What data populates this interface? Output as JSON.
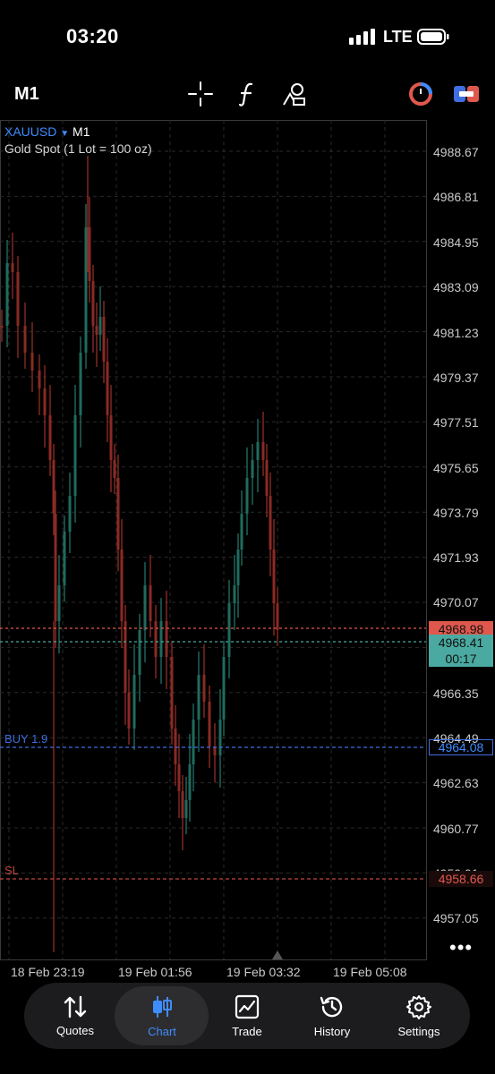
{
  "status": {
    "time": "03:20",
    "network": "LTE"
  },
  "toolbar": {
    "timeframe": "M1"
  },
  "chart": {
    "symbol": "XAUUSD",
    "symbol_tf": "M1",
    "description": "Gold Spot (1 Lot = 100 oz)",
    "price_ticks": [
      "4988.67",
      "4986.81",
      "4984.95",
      "4983.09",
      "4981.23",
      "4979.37",
      "4977.51",
      "4975.65",
      "4973.79",
      "4971.93",
      "4970.07",
      "4966.35",
      "4964.49",
      "4962.63",
      "4960.77",
      "4959.91",
      "4957.05"
    ],
    "ask_tag": "4968.98",
    "bid_tag": "4968.41",
    "bar_timer": "00:17",
    "buy_tag": "4964.08",
    "sl_tag": "4958.66",
    "buy_label": "BUY 1.9",
    "sl_label": "SL",
    "time_labels": [
      "18 Feb 23:19",
      "19 Feb 01:56",
      "19 Feb 03:32",
      "19 Feb 05:08"
    ],
    "colors": {
      "ask_line": "#e0584d",
      "bid_line": "#4aa9a0",
      "buy_line": "#3f6ee0",
      "sl_line": "#c0463d",
      "bull": "#1f6b5e",
      "bear": "#8a2a24"
    }
  },
  "nav": {
    "items": [
      {
        "label": "Quotes"
      },
      {
        "label": "Chart"
      },
      {
        "label": "Trade"
      },
      {
        "label": "History"
      },
      {
        "label": "Settings"
      }
    ],
    "active_color": "#3f8cff"
  }
}
